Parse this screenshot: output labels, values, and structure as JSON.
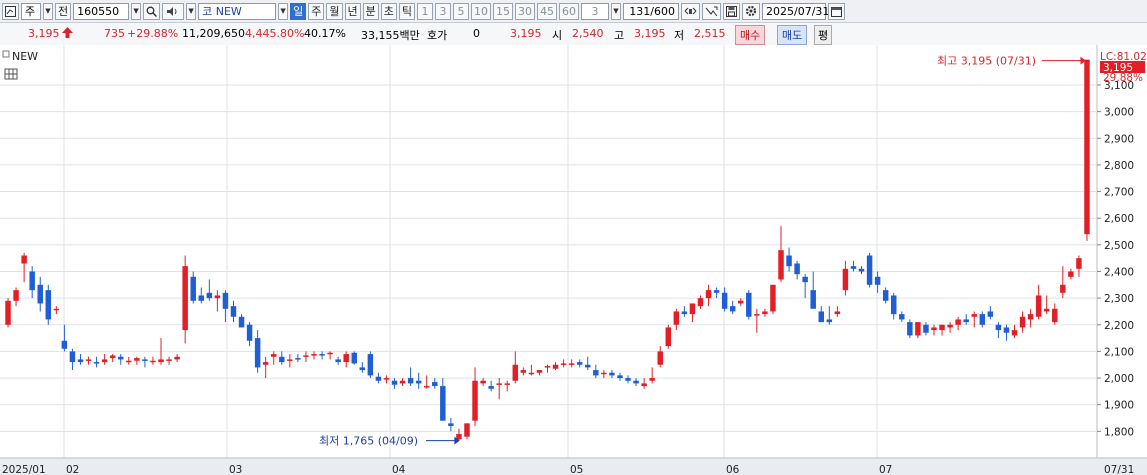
{
  "toolbar": {
    "market_label": "주",
    "all_label": "전",
    "stock_code": "160550",
    "stock_name": "코 NEW",
    "period_tabs": [
      "일",
      "주",
      "월",
      "년",
      "분",
      "초",
      "틱"
    ],
    "active_period": "일",
    "intervals": [
      "1",
      "3",
      "5",
      "10",
      "15",
      "30",
      "45",
      "60"
    ],
    "custom_interval": "3",
    "count_display": "131/600",
    "date_value": "2025/07/31"
  },
  "quote": {
    "price": "3,195",
    "change": "735",
    "change_pct": "+29.88%",
    "volume": "11,209,650",
    "volume_pct": "4,445.80%",
    "turnover": "40.17%",
    "amount": "33,155백만",
    "hoga_label": "호가",
    "hoga_value": "0",
    "hoga_price": "3,195",
    "open_label": "시",
    "open": "2,540",
    "high_label": "고",
    "high": "3,195",
    "low_label": "저",
    "low": "2,515",
    "buy_label": "매수",
    "sell_label": "매도",
    "avg_label": "평"
  },
  "chart_data": {
    "type": "candlestick",
    "title": "NEW",
    "ylim": [
      1700,
      3250
    ],
    "yticks": [
      1800,
      1900,
      2000,
      2100,
      2200,
      2300,
      2400,
      2500,
      2600,
      2700,
      2800,
      2900,
      3000,
      3100
    ],
    "ytick_labels": [
      "1,800",
      "1,900",
      "2,000",
      "2,100",
      "2,200",
      "2,300",
      "2,400",
      "2,500",
      "2,600",
      "2,700",
      "2,800",
      "2,900",
      "3,000",
      "3,100"
    ],
    "x_labels": [
      "2025/01",
      "02",
      "03",
      "04",
      "05",
      "06",
      "07",
      "07/31"
    ],
    "top_right_label": "LC:81.02",
    "last_price_label": "3,195",
    "last_pct_label": "29.88%",
    "high_annotation": "최고 3,195 (07/31)",
    "low_annotation": "최저 1,765 (04/09)",
    "colors": {
      "up": "#e21f26",
      "down": "#1f5fd3",
      "grid": "#dde2ea"
    },
    "candles": [
      [
        2200,
        2300,
        2190,
        2290
      ],
      [
        2290,
        2340,
        2270,
        2330
      ],
      [
        2430,
        2470,
        2360,
        2460
      ],
      [
        2400,
        2420,
        2300,
        2330
      ],
      [
        2350,
        2380,
        2250,
        2280
      ],
      [
        2330,
        2350,
        2200,
        2220
      ],
      [
        2260,
        2270,
        2240,
        2260
      ],
      [
        2140,
        2200,
        2100,
        2110
      ],
      [
        2100,
        2110,
        2030,
        2060
      ],
      [
        2070,
        2090,
        2050,
        2060
      ],
      [
        2070,
        2080,
        2050,
        2070
      ],
      [
        2060,
        2080,
        2040,
        2055
      ],
      [
        2060,
        2090,
        2050,
        2070
      ],
      [
        2075,
        2090,
        2060,
        2085
      ],
      [
        2080,
        2090,
        2050,
        2070
      ],
      [
        2060,
        2080,
        2050,
        2065
      ],
      [
        2065,
        2080,
        2050,
        2075
      ],
      [
        2070,
        2080,
        2040,
        2065
      ],
      [
        2065,
        2080,
        2050,
        2065
      ],
      [
        2060,
        2150,
        2050,
        2070
      ],
      [
        2065,
        2080,
        2050,
        2070
      ],
      [
        2070,
        2090,
        2060,
        2080
      ],
      [
        2180,
        2460,
        2130,
        2420
      ],
      [
        2380,
        2400,
        2280,
        2290
      ],
      [
        2310,
        2340,
        2280,
        2290
      ],
      [
        2320,
        2370,
        2290,
        2300
      ],
      [
        2300,
        2330,
        2250,
        2310
      ],
      [
        2320,
        2330,
        2210,
        2260
      ],
      [
        2270,
        2290,
        2210,
        2230
      ],
      [
        2230,
        2240,
        2190,
        2190
      ],
      [
        2200,
        2210,
        2120,
        2140
      ],
      [
        2150,
        2180,
        2020,
        2040
      ],
      [
        2050,
        2080,
        2000,
        2060
      ],
      [
        2080,
        2100,
        2050,
        2090
      ],
      [
        2080,
        2100,
        2050,
        2060
      ],
      [
        2070,
        2090,
        2040,
        2070
      ],
      [
        2075,
        2090,
        2060,
        2070
      ],
      [
        2080,
        2100,
        2060,
        2085
      ],
      [
        2085,
        2100,
        2070,
        2090
      ],
      [
        2090,
        2100,
        2070,
        2085
      ],
      [
        2095,
        2100,
        2070,
        2095
      ],
      [
        2070,
        2080,
        2050,
        2060
      ],
      [
        2060,
        2100,
        2040,
        2090
      ],
      [
        2095,
        2100,
        2050,
        2055
      ],
      [
        2040,
        2060,
        2020,
        2030
      ],
      [
        2090,
        2100,
        2000,
        2010
      ],
      [
        2005,
        2020,
        1980,
        1990
      ],
      [
        1995,
        2010,
        1980,
        2000
      ],
      [
        1990,
        2000,
        1960,
        1975
      ],
      [
        1980,
        2000,
        1970,
        1990
      ],
      [
        2000,
        2040,
        1970,
        1980
      ],
      [
        1990,
        2020,
        1960,
        1980
      ],
      [
        1970,
        2010,
        1960,
        1970
      ],
      [
        1985,
        2000,
        1960,
        1970
      ],
      [
        1970,
        2000,
        1840,
        1840
      ],
      [
        1830,
        1850,
        1800,
        1820
      ],
      [
        1770,
        1810,
        1765,
        1790
      ],
      [
        1780,
        1830,
        1770,
        1830
      ],
      [
        1840,
        2040,
        1820,
        1990
      ],
      [
        1980,
        2000,
        1970,
        1990
      ],
      [
        1970,
        1990,
        1950,
        1960
      ],
      [
        1980,
        2000,
        1920,
        1980
      ],
      [
        1975,
        1990,
        1950,
        1980
      ],
      [
        1990,
        2100,
        1980,
        2050
      ],
      [
        2020,
        2040,
        2010,
        2030
      ],
      [
        2020,
        2050,
        2010,
        2020
      ],
      [
        2020,
        2030,
        2010,
        2030
      ],
      [
        2040,
        2050,
        2020,
        2045
      ],
      [
        2035,
        2060,
        2030,
        2050
      ],
      [
        2055,
        2070,
        2040,
        2055
      ],
      [
        2050,
        2070,
        2040,
        2055
      ],
      [
        2060,
        2070,
        2040,
        2050
      ],
      [
        2050,
        2080,
        2030,
        2040
      ],
      [
        2030,
        2050,
        2000,
        2010
      ],
      [
        2015,
        2030,
        2000,
        2020
      ],
      [
        2020,
        2030,
        2000,
        2010
      ],
      [
        2010,
        2020,
        1990,
        2000
      ],
      [
        2000,
        2010,
        1980,
        1990
      ],
      [
        1990,
        2000,
        1970,
        1980
      ],
      [
        1970,
        2000,
        1960,
        1980
      ],
      [
        1990,
        2040,
        1980,
        2000
      ],
      [
        2050,
        2120,
        2040,
        2100
      ],
      [
        2120,
        2200,
        2110,
        2190
      ],
      [
        2200,
        2260,
        2180,
        2250
      ],
      [
        2250,
        2270,
        2230,
        2240
      ],
      [
        2240,
        2280,
        2210,
        2280
      ],
      [
        2270,
        2310,
        2260,
        2300
      ],
      [
        2300,
        2350,
        2270,
        2330
      ],
      [
        2330,
        2340,
        2300,
        2320
      ],
      [
        2320,
        2340,
        2250,
        2260
      ],
      [
        2270,
        2290,
        2240,
        2250
      ],
      [
        2280,
        2300,
        2270,
        2290
      ],
      [
        2320,
        2330,
        2220,
        2230
      ],
      [
        2240,
        2260,
        2170,
        2240
      ],
      [
        2240,
        2260,
        2230,
        2250
      ],
      [
        2250,
        2350,
        2240,
        2350
      ],
      [
        2370,
        2570,
        2360,
        2480
      ],
      [
        2460,
        2490,
        2400,
        2420
      ],
      [
        2430,
        2440,
        2370,
        2390
      ],
      [
        2380,
        2390,
        2300,
        2360
      ],
      [
        2330,
        2400,
        2280,
        2260
      ],
      [
        2250,
        2270,
        2210,
        2210
      ],
      [
        2220,
        2270,
        2200,
        2210
      ],
      [
        2240,
        2270,
        2230,
        2250
      ],
      [
        2330,
        2440,
        2310,
        2410
      ],
      [
        2420,
        2440,
        2400,
        2410
      ],
      [
        2410,
        2420,
        2390,
        2400
      ],
      [
        2460,
        2470,
        2340,
        2350
      ],
      [
        2380,
        2400,
        2320,
        2350
      ],
      [
        2330,
        2340,
        2280,
        2290
      ],
      [
        2310,
        2320,
        2220,
        2240
      ],
      [
        2240,
        2250,
        2210,
        2220
      ],
      [
        2210,
        2220,
        2150,
        2160
      ],
      [
        2160,
        2210,
        2150,
        2210
      ],
      [
        2200,
        2210,
        2160,
        2170
      ],
      [
        2180,
        2200,
        2160,
        2190
      ],
      [
        2180,
        2200,
        2160,
        2200
      ],
      [
        2190,
        2210,
        2170,
        2200
      ],
      [
        2200,
        2230,
        2180,
        2220
      ],
      [
        2220,
        2240,
        2200,
        2210
      ],
      [
        2230,
        2250,
        2190,
        2240
      ],
      [
        2240,
        2250,
        2190,
        2200
      ],
      [
        2250,
        2270,
        2220,
        2230
      ],
      [
        2200,
        2210,
        2150,
        2180
      ],
      [
        2190,
        2200,
        2140,
        2170
      ],
      [
        2160,
        2200,
        2150,
        2180
      ],
      [
        2190,
        2250,
        2170,
        2230
      ],
      [
        2220,
        2260,
        2190,
        2240
      ],
      [
        2230,
        2350,
        2220,
        2310
      ],
      [
        2250,
        2310,
        2240,
        2260
      ],
      [
        2210,
        2280,
        2200,
        2260
      ],
      [
        2320,
        2420,
        2300,
        2350
      ],
      [
        2380,
        2410,
        2370,
        2400
      ],
      [
        2410,
        2460,
        2380,
        2450
      ],
      [
        2540,
        3195,
        2515,
        3195
      ]
    ]
  }
}
